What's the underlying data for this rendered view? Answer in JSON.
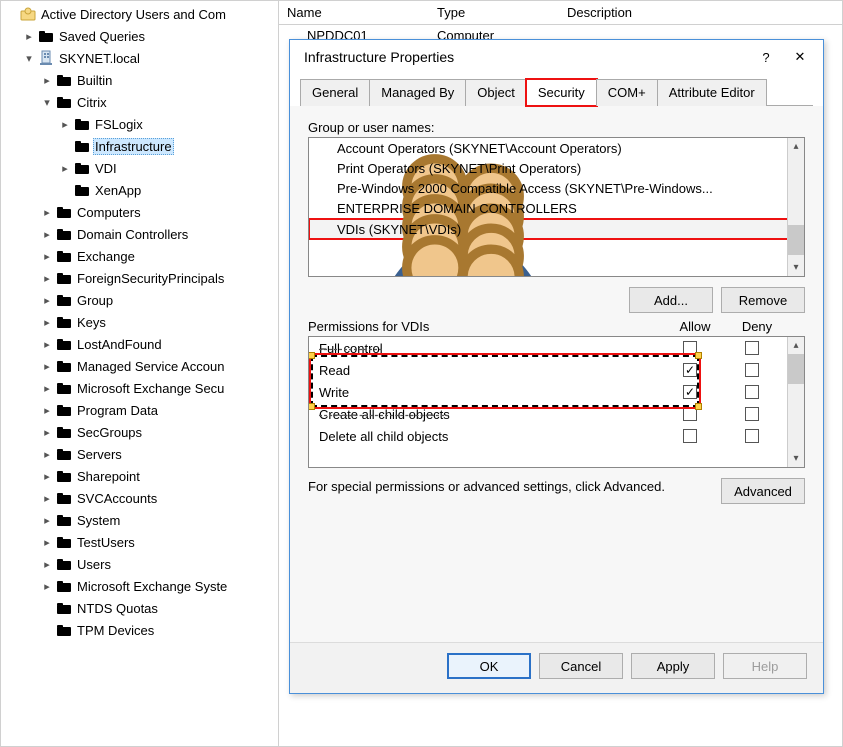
{
  "tree": {
    "root_label": "Active Directory Users and Com",
    "saved_queries": "Saved Queries",
    "domain": "SKYNET.local",
    "builtin": "Builtin",
    "citrix": "Citrix",
    "fslogix": "FSLogix",
    "infrastructure": "Infrastructure",
    "vdi": "VDI",
    "xenapp": "XenApp",
    "computers": "Computers",
    "domain_controllers": "Domain Controllers",
    "exchange": "Exchange",
    "fsp": "ForeignSecurityPrincipals",
    "group": "Group",
    "keys": "Keys",
    "lostfound": "LostAndFound",
    "msa": "Managed Service Accoun",
    "exch_sec": "Microsoft Exchange Secu",
    "program_data": "Program Data",
    "secgroups": "SecGroups",
    "servers": "Servers",
    "sharepoint": "Sharepoint",
    "svcaccounts": "SVCAccounts",
    "system": "System",
    "testusers": "TestUsers",
    "users": "Users",
    "exch_sys": "Microsoft Exchange Syste",
    "ntds": "NTDS Quotas",
    "tpm": "TPM Devices"
  },
  "list": {
    "col_name": "Name",
    "col_type": "Type",
    "col_desc": "Description",
    "row0_name": "NPDDC01",
    "row0_type": "Computer"
  },
  "dialog": {
    "title": "Infrastructure Properties",
    "tabs": {
      "general": "General",
      "managedby": "Managed By",
      "object": "Object",
      "security": "Security",
      "com": "COM+",
      "attreditor": "Attribute Editor"
    },
    "group_label": "Group or user names:",
    "names": {
      "account_ops": "Account Operators (SKYNET\\Account Operators)",
      "print_ops": "Print Operators (SKYNET\\Print Operators)",
      "prewin2000": "Pre-Windows 2000 Compatible Access (SKYNET\\Pre-Windows...",
      "edc": "ENTERPRISE DOMAIN CONTROLLERS",
      "vdis": "VDIs (SKYNET\\VDIs)"
    },
    "btn_add": "Add...",
    "btn_remove": "Remove",
    "perm_label": "Permissions for VDIs",
    "perm_allow": "Allow",
    "perm_deny": "Deny",
    "perms": {
      "full": "Full control",
      "read": "Read",
      "write": "Write",
      "create": "Create all child objects",
      "delete": "Delete all child objects"
    },
    "adv_text": "For special permissions or advanced settings, click Advanced.",
    "btn_advanced": "Advanced",
    "btn_ok": "OK",
    "btn_cancel": "Cancel",
    "btn_apply": "Apply",
    "btn_help": "Help"
  }
}
